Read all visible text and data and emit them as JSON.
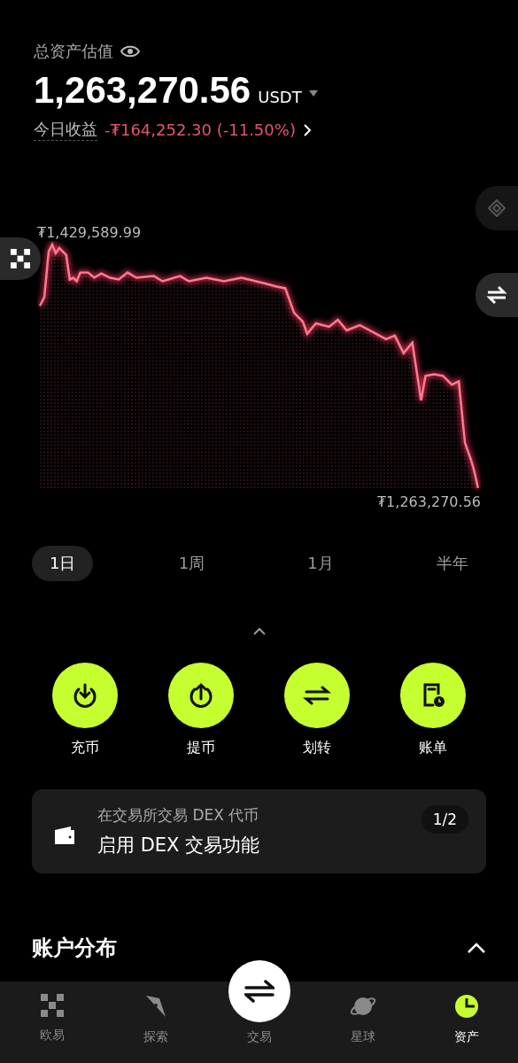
{
  "header": {
    "title": "总资产估值",
    "amount": "1,263,270.56",
    "currency": "USDT",
    "today_label": "今日收益",
    "today_value": "-₮164,252.30 (-11.50%)"
  },
  "chart": {
    "max_label": "₮1,429,589.99",
    "end_label": "₮1,263,270.56"
  },
  "ranges": [
    {
      "label": "1日",
      "selected": true
    },
    {
      "label": "1周",
      "selected": false
    },
    {
      "label": "1月",
      "selected": false
    },
    {
      "label": "半年",
      "selected": false
    }
  ],
  "actions": [
    {
      "kind": "deposit",
      "label": "充币"
    },
    {
      "kind": "withdraw",
      "label": "提币"
    },
    {
      "kind": "transfer",
      "label": "划转"
    },
    {
      "kind": "bill",
      "label": "账单"
    }
  ],
  "banner": {
    "subtitle": "在交易所交易 DEX 代币",
    "title": "启用 DEX 交易功能",
    "pager": "1/2"
  },
  "section": {
    "title": "账户分布",
    "expanded": true
  },
  "nav": [
    {
      "kind": "home",
      "label": "欧易",
      "selected": false
    },
    {
      "kind": "explore",
      "label": "探索",
      "selected": false
    },
    {
      "kind": "trade",
      "label": "交易",
      "selected": false
    },
    {
      "kind": "planet",
      "label": "星球",
      "selected": false
    },
    {
      "kind": "assets",
      "label": "资产",
      "selected": true
    }
  ]
}
